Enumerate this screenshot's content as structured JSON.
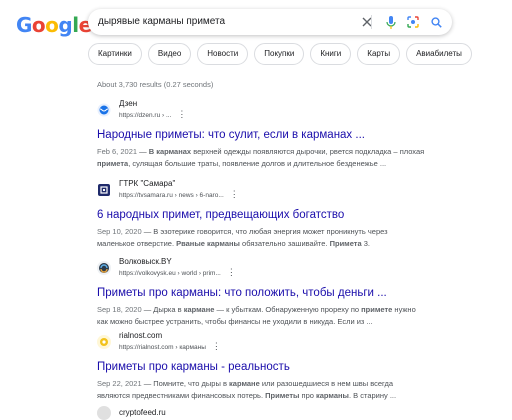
{
  "logo": {
    "letters": [
      "G",
      "o",
      "o",
      "g",
      "l",
      "e"
    ],
    "colors": [
      "#4285F4",
      "#EA4335",
      "#FBBC05",
      "#4285F4",
      "#34A853",
      "#EA4335"
    ]
  },
  "search": {
    "query": "дырявые карманы примета",
    "clear_icon": "close-icon",
    "mic_icon": "mic-icon",
    "lens_icon": "lens-icon",
    "search_icon": "search-icon"
  },
  "chips": [
    "Картинки",
    "Видео",
    "Новости",
    "Покупки",
    "Книги",
    "Карты",
    "Авиабилеты"
  ],
  "stats": "About 3,730 results (0.27 seconds)",
  "results": [
    {
      "site": "Дзен",
      "url": "https://dzen.ru › ...",
      "title": "Народные приметы: что сулит, если в карманах ...",
      "date": "Feb 6, 2021",
      "snippet_parts": [
        " — ",
        "В карманах",
        " верхней одежды появляются дырочки, рвется подкладка – плохая ",
        "примета",
        ", сулящая большие траты, появление долгов и длительное безденежье ..."
      ],
      "favicon_color": "#1a73e8"
    },
    {
      "site": "ГТРК \"Самара\"",
      "url": "https://tvsamara.ru › news › 6-naro...",
      "title": "6 народных примет, предвещающих богатство",
      "date": "Sep 10, 2020",
      "snippet_parts": [
        " — В эзотерике говорится, что любая энергия может проникнуть через маленькое отверстие. ",
        "Рваные карманы",
        " обязательно зашивайте. ",
        "Примета",
        " 3."
      ],
      "favicon_color": "#1f2a6b"
    },
    {
      "site": "Волковыск.BY",
      "url": "https://volkovysk.eu › world › prim...",
      "title": "Приметы про карманы: что положить, чтобы деньги ...",
      "date": "Sep 18, 2020",
      "snippet_parts": [
        " — Дырка в ",
        "кармане",
        " — к убыткам. Обнаруженную прореху по ",
        "примете",
        " нужно как можно быстрее устранить, чтобы финансы не уходили в никуда. Если из ..."
      ],
      "favicon_color": "#2b3a4a"
    },
    {
      "site": "rialnost.com",
      "url": "https://rialnost.com › карманы",
      "title": "Приметы про карманы - реальность",
      "date": "Sep 22, 2021",
      "snippet_parts": [
        " — Помните, что дыры в ",
        "кармане",
        " или разошедшиеся в нем швы всегда являются предвестниками финансовых потерь. ",
        "Приметы",
        " про ",
        "карманы",
        ". В старину ..."
      ],
      "favicon_color": "#f2c21b"
    },
    {
      "site": "cryptofeed.ru",
      "url": "",
      "title": "",
      "date": "",
      "snippet_parts": [],
      "favicon_color": "#cccccc"
    }
  ]
}
